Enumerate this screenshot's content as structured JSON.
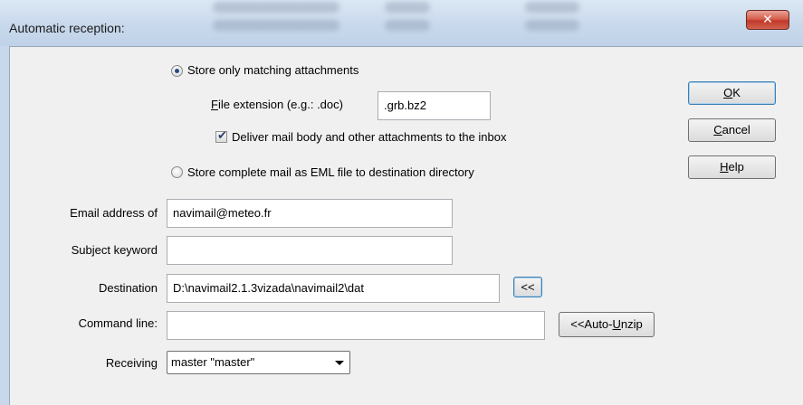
{
  "window": {
    "title": "Automatic reception:",
    "close_glyph": "✕"
  },
  "storage_mode": {
    "option_attachments_label": "Store only matching attachments",
    "option_attachments_selected": true,
    "file_extension_label_prefix": "F",
    "file_extension_label_rest": "ile extension (e.g.: .doc)",
    "file_extension_value": ".grb.bz2",
    "deliver_label": "Deliver mail body and other attachments to the inbox",
    "deliver_checked": true,
    "option_eml_label": "Store complete mail as EML file to destination directory",
    "option_eml_selected": false
  },
  "fields": {
    "email_label": "Email address of",
    "email_value": "navimail@meteo.fr",
    "subject_label": "Subject keyword",
    "subject_value": "",
    "destination_label": "Destination",
    "destination_value": "D:\\navimail2.1.3vizada\\navimail2\\dat",
    "browse_label": "<<",
    "command_label": "Command line:",
    "command_value": "",
    "auto_unzip_prefix": "<<Auto-",
    "auto_unzip_accel": "U",
    "auto_unzip_rest": "nzip",
    "receiving_label": "Receiving",
    "receiving_value": "master \"master\""
  },
  "buttons": {
    "ok_accel": "O",
    "ok_rest": "K",
    "cancel_accel": "C",
    "cancel_rest": "ancel",
    "help_accel": "H",
    "help_rest": "elp"
  },
  "icons": {
    "close": "close-icon",
    "dropdown": "chevron-down-icon",
    "check": "checkmark-icon"
  }
}
